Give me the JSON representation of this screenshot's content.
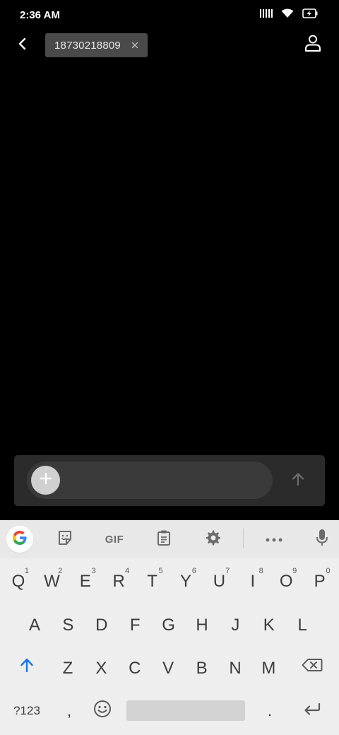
{
  "status_bar": {
    "time": "2:36 AM",
    "icons": [
      "signal-icon",
      "wifi-icon",
      "battery-charging-icon"
    ]
  },
  "header": {
    "back_icon": "back-arrow-icon",
    "recipient_chip": {
      "label": "18730218809",
      "close_icon": "close-icon"
    },
    "contact_icon": "person-icon"
  },
  "compose": {
    "add_icon": "plus-icon",
    "input_value": "",
    "input_placeholder": "",
    "send_icon": "send-arrow-icon"
  },
  "keyboard": {
    "toolbar": {
      "items": [
        "google-icon",
        "sticker-icon",
        "gif",
        "clipboard-icon",
        "settings-icon",
        "more-icon",
        "microphone-icon"
      ],
      "gif_label": "GIF"
    },
    "rows": [
      [
        {
          "k": "Q",
          "h": "1"
        },
        {
          "k": "W",
          "h": "2"
        },
        {
          "k": "E",
          "h": "3"
        },
        {
          "k": "R",
          "h": "4"
        },
        {
          "k": "T",
          "h": "5"
        },
        {
          "k": "Y",
          "h": "6"
        },
        {
          "k": "U",
          "h": "7"
        },
        {
          "k": "I",
          "h": "8"
        },
        {
          "k": "O",
          "h": "9"
        },
        {
          "k": "P",
          "h": "0"
        }
      ],
      [
        {
          "k": "A"
        },
        {
          "k": "S"
        },
        {
          "k": "D"
        },
        {
          "k": "F"
        },
        {
          "k": "G"
        },
        {
          "k": "H"
        },
        {
          "k": "J"
        },
        {
          "k": "K"
        },
        {
          "k": "L"
        }
      ],
      [
        {
          "k": "Z"
        },
        {
          "k": "X"
        },
        {
          "k": "C"
        },
        {
          "k": "V"
        },
        {
          "k": "B"
        },
        {
          "k": "N"
        },
        {
          "k": "M"
        }
      ]
    ],
    "bottom": {
      "symbols_label": "?123",
      "comma_label": ",",
      "period_label": "."
    },
    "colors": {
      "accent": "#1a73e8",
      "key_text": "#3c3c3c",
      "background": "#eeeeee"
    }
  }
}
